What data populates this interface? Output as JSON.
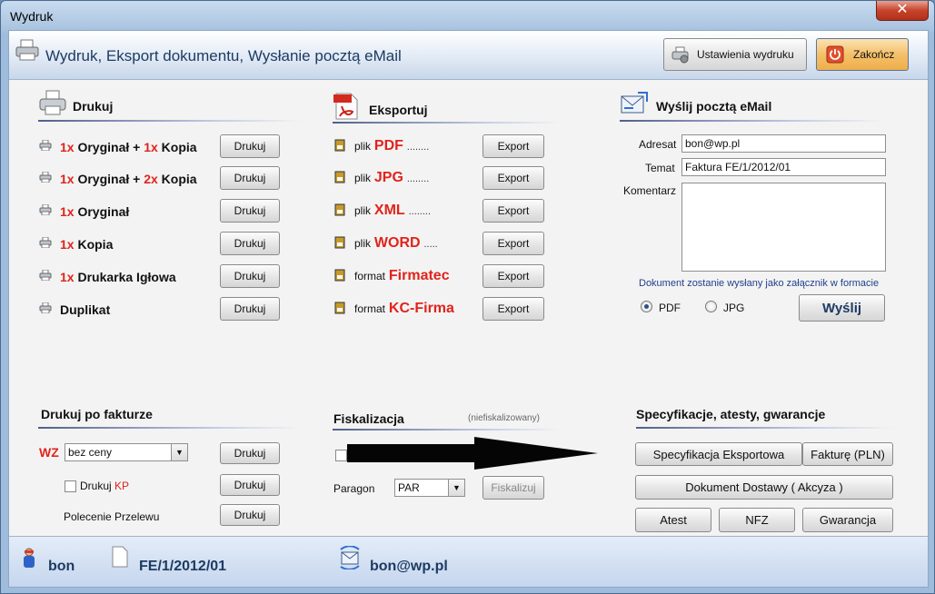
{
  "window": {
    "title": "Wydruk",
    "close_glyph": "✕"
  },
  "header": {
    "title": "Wydruk,  Eksport dokumentu,  Wysłanie pocztą eMail",
    "settings_button": "Ustawienia wydruku",
    "close_button": "Zakończ"
  },
  "print": {
    "title": "Drukuj",
    "rows": [
      {
        "n1": "1x",
        "t1": " Oryginał + ",
        "n2": "1x",
        "t2": " Kopia",
        "button": "Drukuj"
      },
      {
        "n1": "1x",
        "t1": " Oryginał + ",
        "n2": "2x",
        "t2": " Kopia",
        "button": "Drukuj"
      },
      {
        "n1": "1x",
        "t1": " Oryginał",
        "n2": "",
        "t2": "",
        "button": "Drukuj"
      },
      {
        "n1": "1x",
        "t1": " Kopia",
        "n2": "",
        "t2": "",
        "button": "Drukuj"
      },
      {
        "n1": "1x",
        "t1": " Drukarka Igłowa",
        "n2": "",
        "t2": "",
        "button": "Drukuj"
      },
      {
        "n1": "",
        "t1": "Duplikat",
        "n2": "",
        "t2": "",
        "button": "Drukuj"
      }
    ]
  },
  "export": {
    "title": "Eksportuj",
    "rows": [
      {
        "prefix": "plik",
        "format": "PDF",
        "dots": "........",
        "button": "Export"
      },
      {
        "prefix": "plik",
        "format": "JPG",
        "dots": "........",
        "button": "Export"
      },
      {
        "prefix": "plik",
        "format": "XML",
        "dots": "........",
        "button": "Export"
      },
      {
        "prefix": "plik",
        "format": "WORD",
        "dots": ".....",
        "button": "Export"
      },
      {
        "prefix": "format",
        "format": "Firmatec",
        "dots": "",
        "button": "Export"
      },
      {
        "prefix": "format",
        "format": "KC-Firma",
        "dots": "",
        "button": "Export"
      }
    ]
  },
  "email": {
    "title": "Wyślij pocztą eMail",
    "address_label": "Adresat",
    "address_value": "bon@wp.pl",
    "subject_label": "Temat",
    "subject_value": "Faktura FE/1/2012/01",
    "comment_label": "Komentarz",
    "comment_value": "",
    "note": "Dokument zostanie wysłany jako załącznik w formacie",
    "option_pdf": "PDF",
    "option_jpg": "JPG",
    "selected": "PDF",
    "send_button": "Wyślij"
  },
  "after_invoice": {
    "title": "Drukuj po fakturze",
    "wz_label": "WZ",
    "wz_select": "bez ceny",
    "wz_button": "Drukuj",
    "kp_label": "Drukuj ",
    "kp_red": "KP",
    "kp_button": "Drukuj",
    "transfer_label": "Polecenie Przelewu",
    "transfer_button": "Drukuj"
  },
  "fiscal": {
    "title": "Fiskalizacja",
    "status": "(niefiskalizowany)",
    "paragon_label": "Paragon",
    "paragon_select": "PAR",
    "button": "Fiskalizuj"
  },
  "spec": {
    "title": "Specyfikacje, atesty, gwarancje",
    "export_spec": "Specyfikacja Eksportowa",
    "invoice_pln": "Fakturę (PLN)",
    "delivery_doc": "Dokument Dostawy ( Akcyza )",
    "atest": "Atest",
    "nfz": "NFZ",
    "warranty": "Gwarancja"
  },
  "footer": {
    "user": "bon",
    "document": "FE/1/2012/01",
    "email": "bon@wp.pl"
  },
  "colors": {
    "accent_red": "#e1231c",
    "header_text": "#1d3b63"
  }
}
